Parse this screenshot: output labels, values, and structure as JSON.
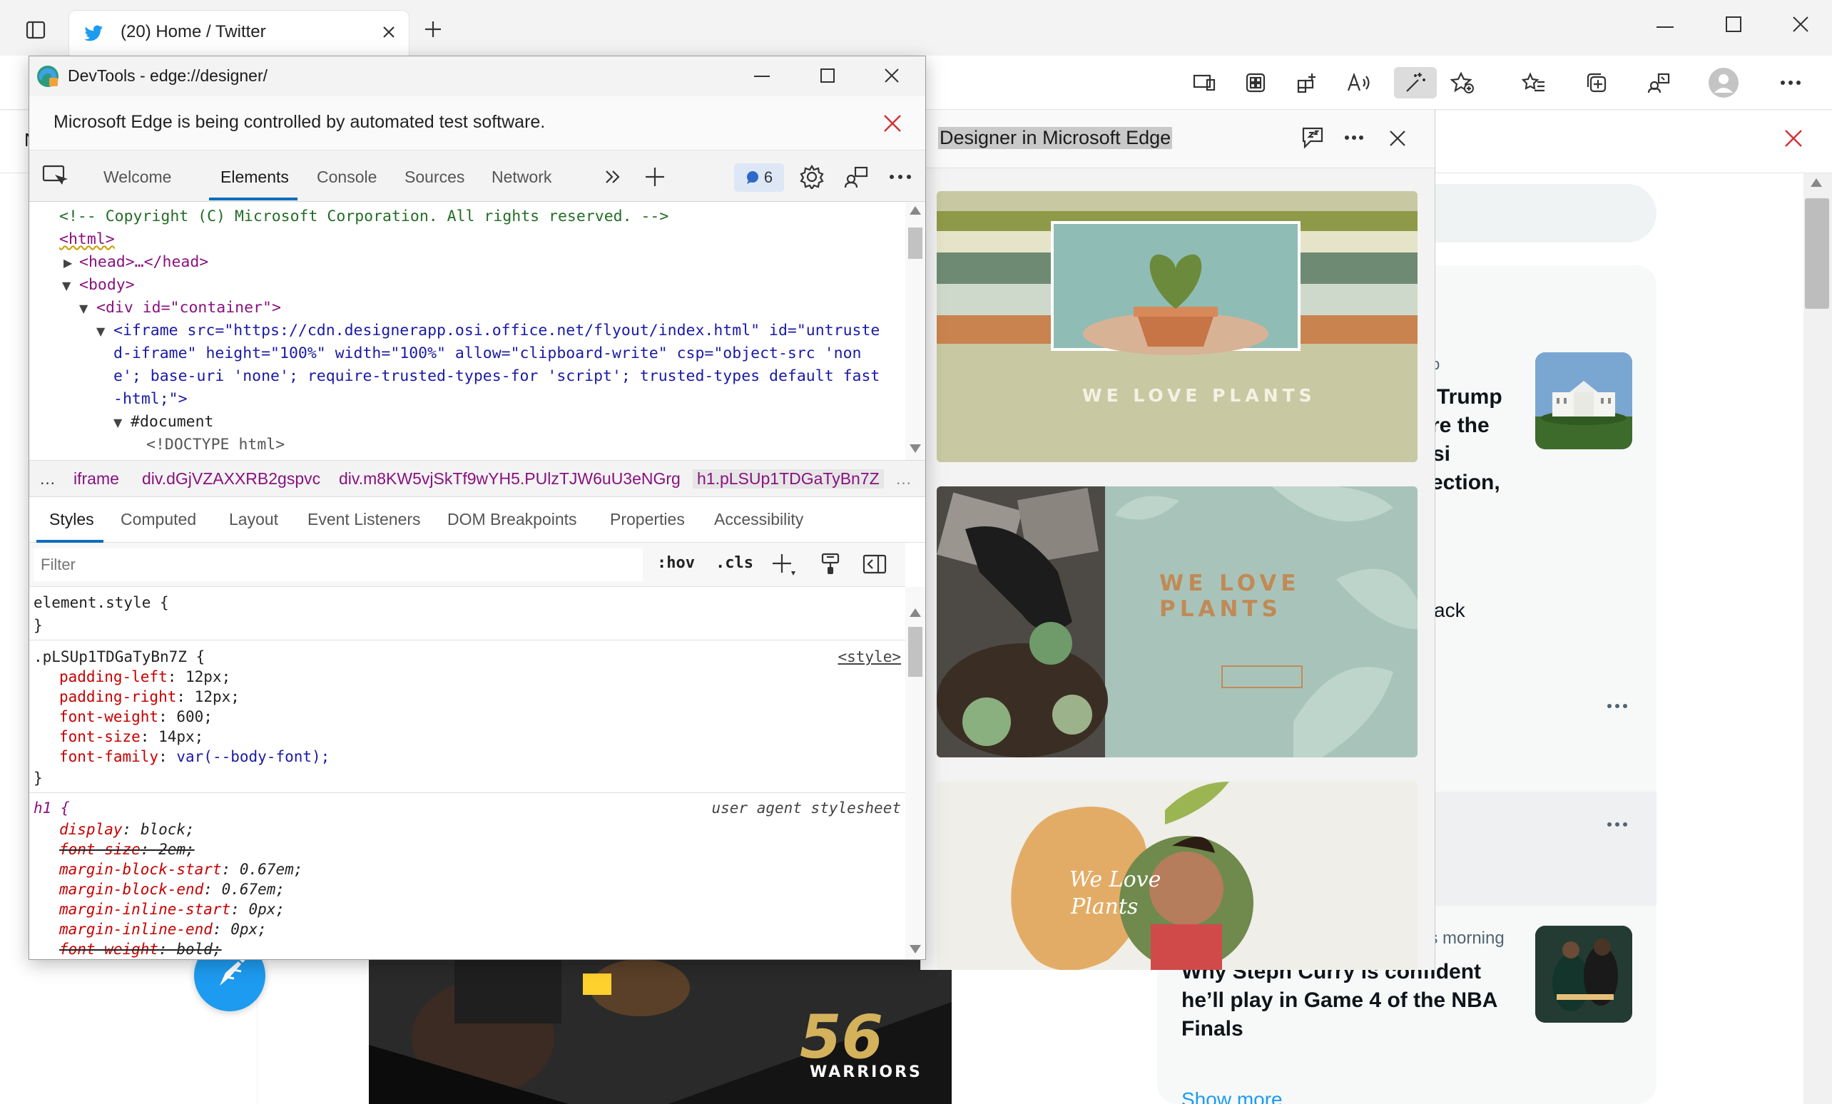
{
  "browser": {
    "tab_title": "(20) Home / Twitter",
    "notice_close": "×"
  },
  "devtools": {
    "window_title": "DevTools - edge://designer/",
    "infobar_text": "Microsoft Edge is being controlled by automated test software.",
    "tabs": [
      "Welcome",
      "Elements",
      "Console",
      "Sources",
      "Network"
    ],
    "active_tab": "Elements",
    "issues_count": "6",
    "dom": {
      "comment": "<!-- Copyright (C) Microsoft Corporation. All rights reserved. -->",
      "html": "<html>",
      "head": "<head>…</head>",
      "body": "<body>",
      "div": "<div id=\"container\">",
      "iframe_l1": "<iframe src=\"https://cdn.designerapp.osi.office.net/flyout/index.html\" id=\"untruste",
      "iframe_l2": "d-iframe\" height=\"100%\" width=\"100%\" allow=\"clipboard-write\" csp=\"object-src 'non",
      "iframe_l3": "e'; base-uri 'none'; require-trusted-types-for 'script'; trusted-types default fast",
      "iframe_l4": "-html;\">",
      "document": "#document",
      "doctype": "<!DOCTYPE html>"
    },
    "breadcrumbs": [
      "iframe",
      "div.dGjVZAXXRB2gspvc",
      "div.m8KW5vjSkTf9wYH5.PUlzTJW6uU3eNGrg",
      "h1.pLSUp1TDGaTyBn7Z"
    ],
    "styles_tabs": [
      "Styles",
      "Computed",
      "Layout",
      "Event Listeners",
      "DOM Breakpoints",
      "Properties",
      "Accessibility"
    ],
    "filter_placeholder": "Filter",
    "hov": ":hov",
    "cls": ".cls",
    "rules": {
      "element_style": "element.style {",
      "close": "}",
      "class_selector": ".pLSUp1TDGaTyBn7Z {",
      "class_source": "<style>",
      "class_props": [
        {
          "name": "padding-left",
          "value": "12px;"
        },
        {
          "name": "padding-right",
          "value": "12px;"
        },
        {
          "name": "font-weight",
          "value": "600;"
        },
        {
          "name": "font-size",
          "value": "14px;"
        },
        {
          "name": "font-family",
          "value": "var(--body-font);"
        }
      ],
      "ua_selector": "h1 {",
      "ua_source": "user agent stylesheet",
      "ua_props": [
        {
          "name": "display",
          "value": "block;"
        },
        {
          "name": "font-size",
          "value": "2em;"
        },
        {
          "name": "margin-block-start",
          "value": "0.67em;"
        },
        {
          "name": "margin-block-end",
          "value": "0.67em;"
        },
        {
          "name": "margin-inline-start",
          "value": "0px;"
        },
        {
          "name": "margin-inline-end",
          "value": "0px;"
        },
        {
          "name": "font-weight",
          "value": "bold;"
        }
      ]
    }
  },
  "designer": {
    "title": "Designer in Microsoft Edge",
    "card1_text": "WE LOVE PLANTS",
    "card2_text": "WE LOVE PLANTS",
    "card3_text_1": "We Love",
    "card3_text_2": "Plants"
  },
  "twitter": {
    "trend1_a": "Trump",
    "trend1_b": "re the",
    "trend1_c": "si",
    "trend1_d": "ection,",
    "trend2": "ack",
    "news_time": "is morning",
    "news_l1": "Why Steph Curry is confident",
    "news_l2": "he’ll play in Game 4 of the NBA",
    "news_l3": "Finals",
    "show_more": "Show more",
    "jersey_number": "56",
    "jersey_team": "WARRIORS",
    "partial_n": "N",
    "partial_p": "p"
  },
  "colors": {
    "accent": "#0f6cbd",
    "twitter_blue": "#1d9bf0",
    "infobar_close": "#d13438"
  }
}
